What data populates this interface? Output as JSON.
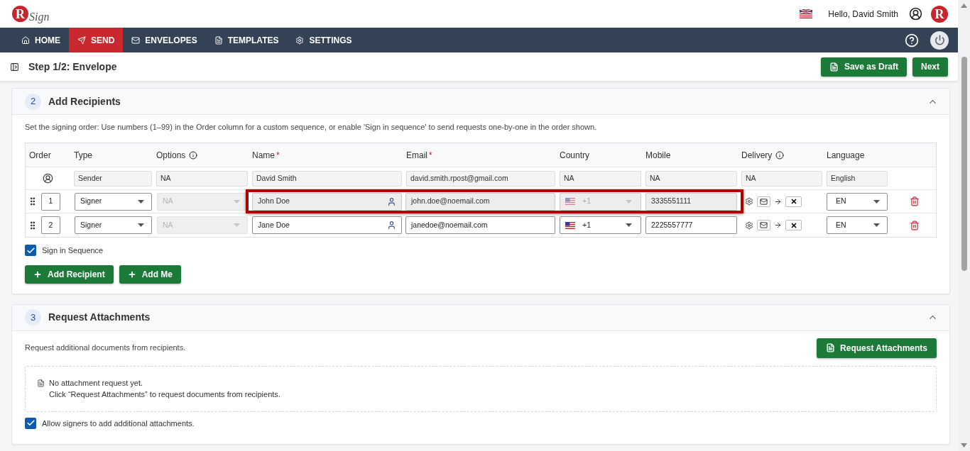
{
  "header": {
    "logo": {
      "badge": "R",
      "text": "Sign"
    },
    "greeting": "Hello, David Smith",
    "brand_badge": "R"
  },
  "nav": {
    "items": [
      {
        "label": "HOME",
        "selected": false
      },
      {
        "label": "SEND",
        "selected": true
      },
      {
        "label": "ENVELOPES",
        "selected": false
      },
      {
        "label": "TEMPLATES",
        "selected": false
      },
      {
        "label": "SETTINGS",
        "selected": false
      }
    ]
  },
  "step_bar": {
    "title": "Step 1/2: Envelope",
    "buttons": [
      {
        "kind": "draft",
        "label": "Save as Draft"
      },
      {
        "kind": "next",
        "label": "Next"
      }
    ]
  },
  "recipients_section": {
    "number": "2",
    "title": "Add Recipients",
    "expanded": true,
    "description": "Set the signing order: Use numbers (1–99) in the Order column for a custom sequence, or enable 'Sign in sequence' to send requests one-by-one in the order shown.",
    "columns": [
      {
        "label": "Order",
        "info": false
      },
      {
        "label": "Type",
        "info": false
      },
      {
        "label": "Options",
        "info": true
      },
      {
        "label": "Name",
        "mark": "*",
        "info": false
      },
      {
        "label": "Email",
        "mark": "*",
        "info": false
      },
      {
        "label": "Country",
        "info": false
      },
      {
        "label": "Mobile",
        "info": false
      },
      {
        "label": "Delivery",
        "info": true
      },
      {
        "label": "Language",
        "info": false
      }
    ],
    "sender": {
      "type": "Sender",
      "options": "NA",
      "name": "David Smith",
      "email": "david.smith.rpost@gmail.com",
      "country": "NA",
      "mobile": "NA",
      "delivery": "NA",
      "language": "English"
    },
    "recipients": [
      {
        "order": "1",
        "type": "Signer",
        "options": "NA",
        "options_disabled": true,
        "name": "John Doe",
        "email": "john.doe@noemail.com",
        "country_code": "+1",
        "mobile": "3335551111",
        "language": "EN",
        "highlighted": true
      },
      {
        "order": "2",
        "type": "Signer",
        "options": "NA",
        "options_disabled": true,
        "name": "Jane Doe",
        "email": "janedoe@noemail.com",
        "country_code": "+1",
        "mobile": "2225557777",
        "language": "EN",
        "highlighted": false
      }
    ],
    "sign_in_sequence": {
      "label": "Sign in Sequence",
      "checked": true
    },
    "buttons": [
      "Add Recipient",
      "Add Me"
    ]
  },
  "attachments_section": {
    "number": "3",
    "title": "Request Attachments",
    "expanded": true,
    "description": "Request additional documents from recipients.",
    "request_button": "Request Attachments",
    "empty_state": {
      "title": "No attachment request yet.",
      "hint": "Click “Request Attachments” to request documents from recipients."
    },
    "allow_additional": {
      "label": "Allow signers to add additional attachments.",
      "checked": true
    }
  }
}
